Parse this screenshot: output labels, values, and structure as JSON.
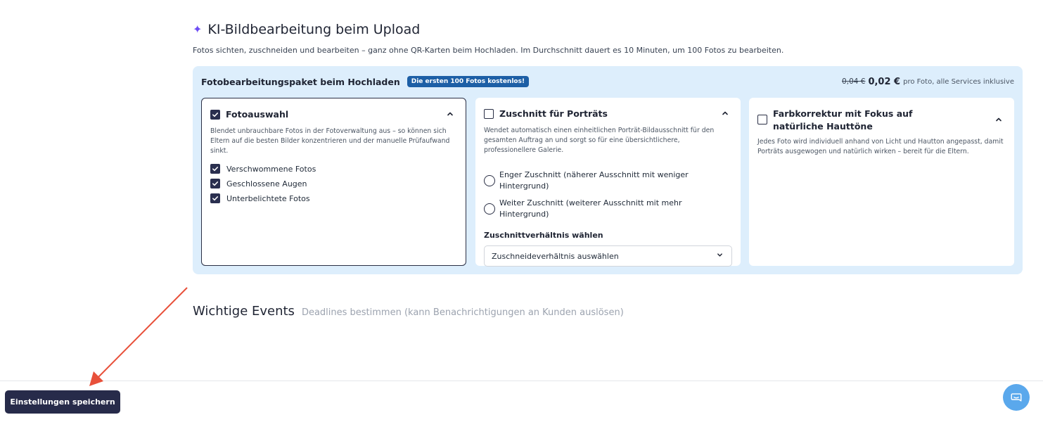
{
  "section": {
    "icon": "sparkle-icon",
    "title": "KI-Bildbearbeitung beim Upload",
    "subtitle": "Fotos sichten, zuschneiden und bearbeiten – ganz ohne QR-Karten beim Hochladen. Im Durchschnitt dauert es 10 Minuten, um 100 Fotos zu bearbeiten."
  },
  "package": {
    "title": "Fotobearbeitungspaket beim Hochladen",
    "badge": "Die ersten 100 Fotos kostenlos!",
    "price_old": "0,04 €",
    "price_new": "0,02 €",
    "price_suffix": "pro Foto, alle Services inklusive"
  },
  "cards": [
    {
      "title": "Fotoauswahl",
      "checked": true,
      "description": "Blendet unbrauchbare Fotos in der Fotoverwaltung aus – so können sich Eltern auf die besten Bilder konzentrieren und der manuelle Prüfaufwand sinkt.",
      "options": [
        {
          "label": "Verschwommene Fotos",
          "checked": true
        },
        {
          "label": "Geschlossene Augen",
          "checked": true
        },
        {
          "label": "Unterbelichtete Fotos",
          "checked": true
        }
      ]
    },
    {
      "title": "Zuschnitt für Porträts",
      "checked": false,
      "description": "Wendet automatisch einen einheitlichen Porträt-Bildausschnitt für den gesamten Auftrag an und sorgt so für eine übersichtlichere, professionellere Galerie.",
      "radios": [
        {
          "label": "Enger Zuschnitt (näherer Ausschnitt mit weniger Hintergrund)"
        },
        {
          "label": "Weiter Zuschnitt (weiterer Ausschnitt mit mehr Hintergrund)"
        }
      ],
      "ratio_label": "Zuschnittverhältnis wählen",
      "ratio_placeholder": "Zuschneideverhältnis auswählen"
    },
    {
      "title": "Farbkorrektur mit Fokus auf natürliche Hauttöne",
      "checked": false,
      "description": "Jedes Foto wird individuell anhand von Licht und Hautton angepasst, damit Porträts ausgewogen und natürlich wirken – bereit für die Eltern."
    }
  ],
  "events": {
    "title": "Wichtige Events",
    "subtitle": "Deadlines bestimmen (kann Benachrichtigungen an Kunden auslösen)"
  },
  "footer": {
    "save_label": "Einstellungen speichern",
    "chat_icon": "chat-bubble-icon"
  },
  "colors": {
    "accent": "#272b4a",
    "package_bg": "#ddeefc",
    "badge": "#1d5fa6",
    "sparkle": "#6d4cf5",
    "annotation_arrow": "#e8503a",
    "chat": "#5aa8ec"
  }
}
